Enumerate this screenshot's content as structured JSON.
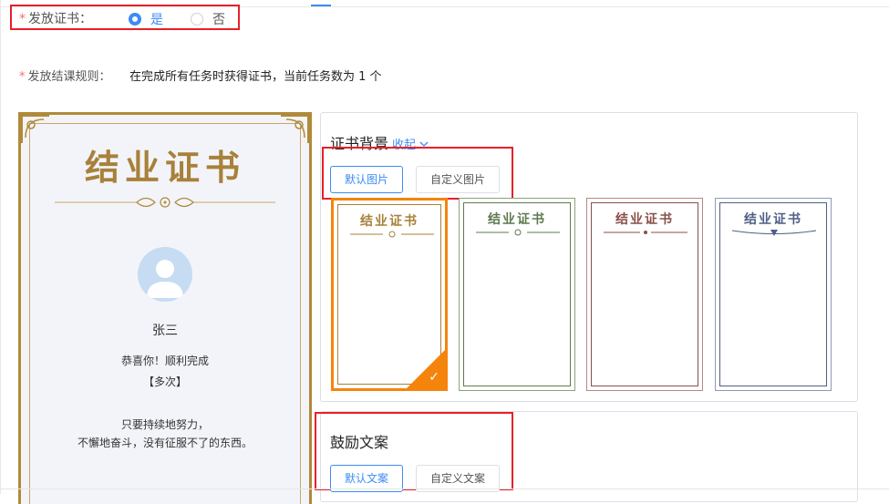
{
  "form": {
    "issue_certificate": {
      "required_mark": "*",
      "label": "发放证书：",
      "options": [
        {
          "label": "是",
          "selected": true
        },
        {
          "label": "否",
          "selected": false
        }
      ]
    },
    "completion_rule": {
      "required_mark": "*",
      "label": "发放结课规则：",
      "text": "在完成所有任务时获得证书，当前任务数为 1 个"
    }
  },
  "preview": {
    "title": "结业证书",
    "name": "张三",
    "congrats": "恭喜你！顺利完成",
    "times": "【多次】",
    "motto_line1": "只要持续地努力，",
    "motto_line2": "不懈地奋斗，没有征服不了的东西。",
    "frame_color": "#b08a3a"
  },
  "background_panel": {
    "title": "证书背景",
    "collapse_label": "收起",
    "tabs": [
      {
        "label": "默认图片",
        "active": true
      },
      {
        "label": "自定义图片",
        "active": false
      }
    ],
    "thumbnails": [
      {
        "title": "结业证书",
        "color": "#a8813a",
        "selected": true
      },
      {
        "title": "结业证书",
        "color": "#5f7a4f",
        "selected": false
      },
      {
        "title": "结业证书",
        "color": "#8a4f4a",
        "selected": false
      },
      {
        "title": "结业证书",
        "color": "#4f5f85",
        "selected": false
      }
    ],
    "selected_border_color": "#f5840c"
  },
  "text_panel": {
    "title": "鼓励文案",
    "tabs": [
      {
        "label": "默认文案",
        "active": true
      },
      {
        "label": "自定义文案",
        "active": false
      }
    ]
  },
  "colors": {
    "accent": "#3d8bf5",
    "highlight_box": "#e7202a"
  }
}
